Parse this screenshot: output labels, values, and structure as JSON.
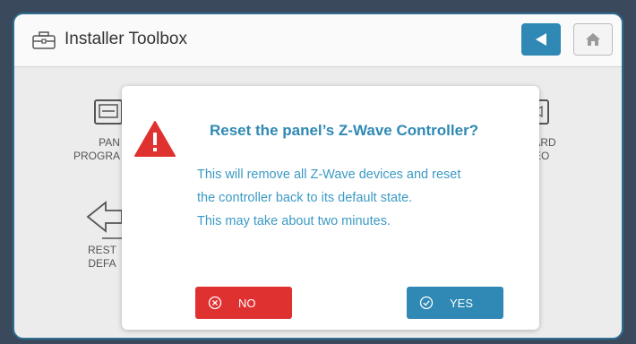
{
  "header": {
    "title": "Installer Toolbox",
    "title_icon": "toolbox-icon",
    "back_icon": "back-arrow-icon",
    "home_icon": "home-icon"
  },
  "background_tiles": [
    {
      "label_line1": "PAN",
      "label_line2": "PROGRA",
      "icon": "panel-icon"
    },
    {
      "label_line1": "OARD",
      "label_line2": "DEO",
      "icon": "video-icon"
    },
    {
      "label_line1": "REST",
      "label_line2": "DEFA",
      "icon": "arrow-left-icon"
    }
  ],
  "dialog": {
    "icon": "warning-icon",
    "title": "Reset the panel’s Z-Wave Controller?",
    "body_lines": [
      "This will remove all Z-Wave devices and reset",
      "the controller back to its default state.",
      "This may take about two minutes."
    ],
    "no_label": "NO",
    "yes_label": "YES"
  },
  "colors": {
    "accent": "#2f89b4",
    "danger": "#e03131"
  }
}
